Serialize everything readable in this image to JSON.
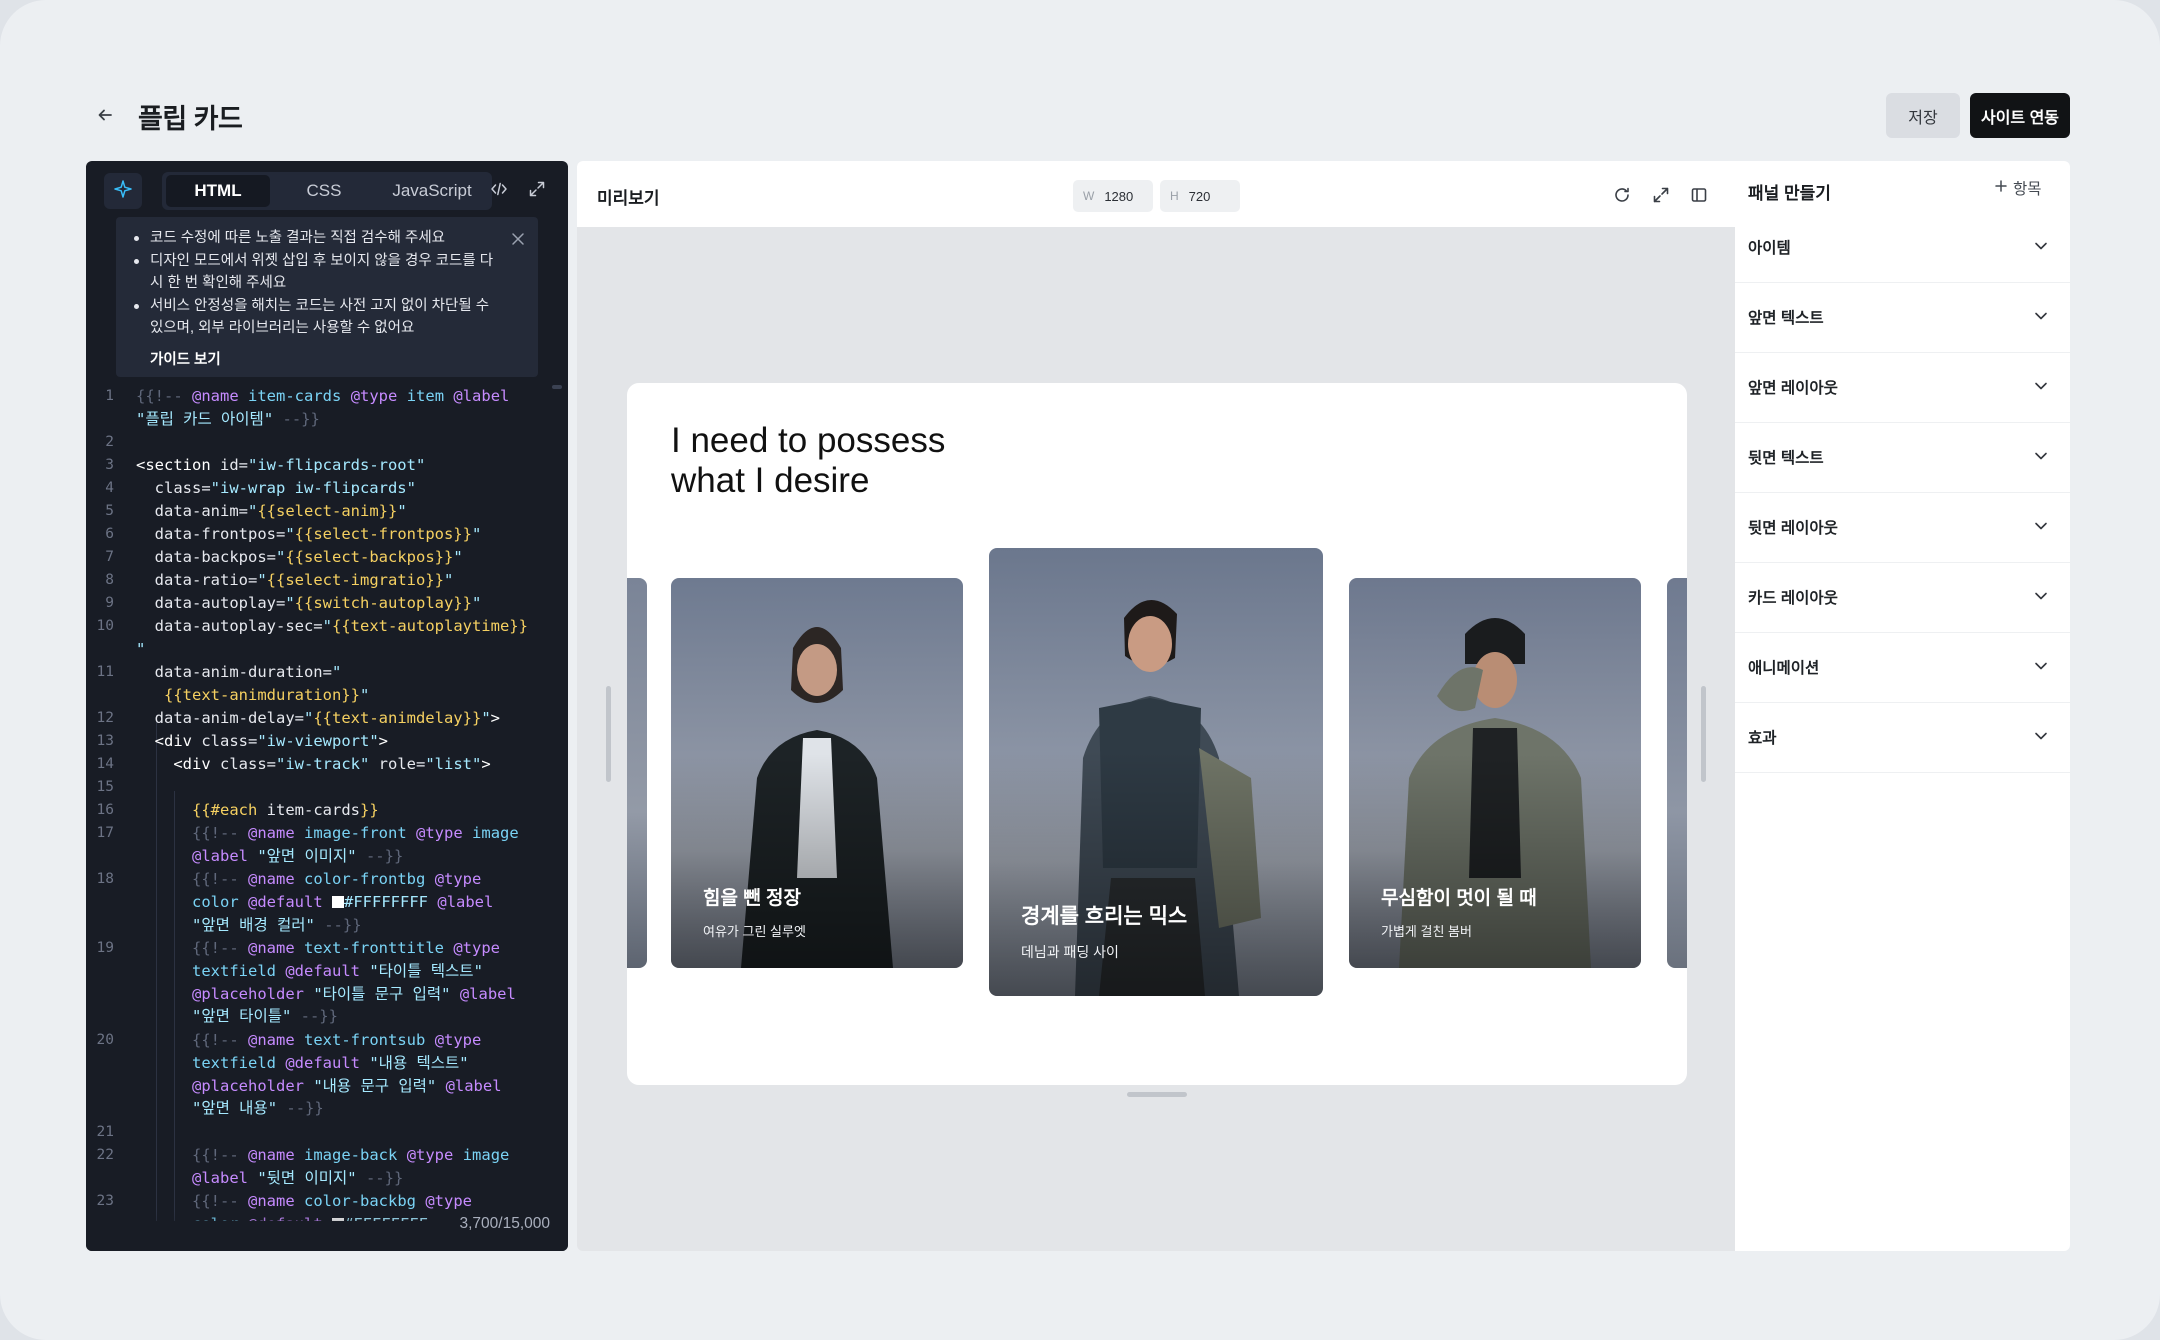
{
  "header": {
    "title": "플립 카드",
    "save_label": "저장",
    "sync_label": "사이트 연동"
  },
  "code_panel": {
    "tabs": [
      "HTML",
      "CSS",
      "JavaScript"
    ],
    "active_tab": "HTML",
    "notices": [
      "코드 수정에 따른 노출 결과는 직접 검수해 주세요",
      "디자인 모드에서 위젯 삽입 후 보이지 않을 경우 코드를 다시 한 번 확인해 주세요",
      "서비스 안정성을 해치는 코드는 사전 고지 없이 차단될 수 있으며, 외부 라이브러리는 사용할 수 없어요"
    ],
    "guide_link": "가이드 보기",
    "char_count": "3,700/15,000",
    "line_numbers": [
      "1",
      "2",
      "3",
      "4",
      "5",
      "6",
      "7",
      "8",
      "9",
      "10",
      "11",
      "12",
      "13",
      "14",
      "15",
      "16",
      "17",
      "18",
      "19",
      "20",
      "21",
      "22",
      "23"
    ]
  },
  "preview": {
    "title": "미리보기",
    "width_label": "W",
    "width_value": "1280",
    "height_label": "H",
    "height_value": "720",
    "hero_line1": "I need to possess",
    "hero_line2": "what I desire",
    "cards": [
      {
        "title": "힘을 뺀 정장",
        "subtitle": "여유가 그린 실루엣"
      },
      {
        "title": "경계를 흐리는 믹스",
        "subtitle": "데님과 패딩 사이"
      },
      {
        "title": "무심함이 멋이 될 때",
        "subtitle": "가볍게 걸친 봄버"
      }
    ]
  },
  "side_panel": {
    "title": "패널 만들기",
    "add_label": "항목",
    "sections": [
      "아이템",
      "앞면 텍스트",
      "앞면 레이아웃",
      "뒷면 텍스트",
      "뒷면 레이아웃",
      "카드 레이아웃",
      "애니메이션",
      "효과"
    ]
  },
  "colors": {
    "accent_dark": "#111315",
    "editor_bg": "#181c25",
    "sparkle": "#38bdf8"
  }
}
